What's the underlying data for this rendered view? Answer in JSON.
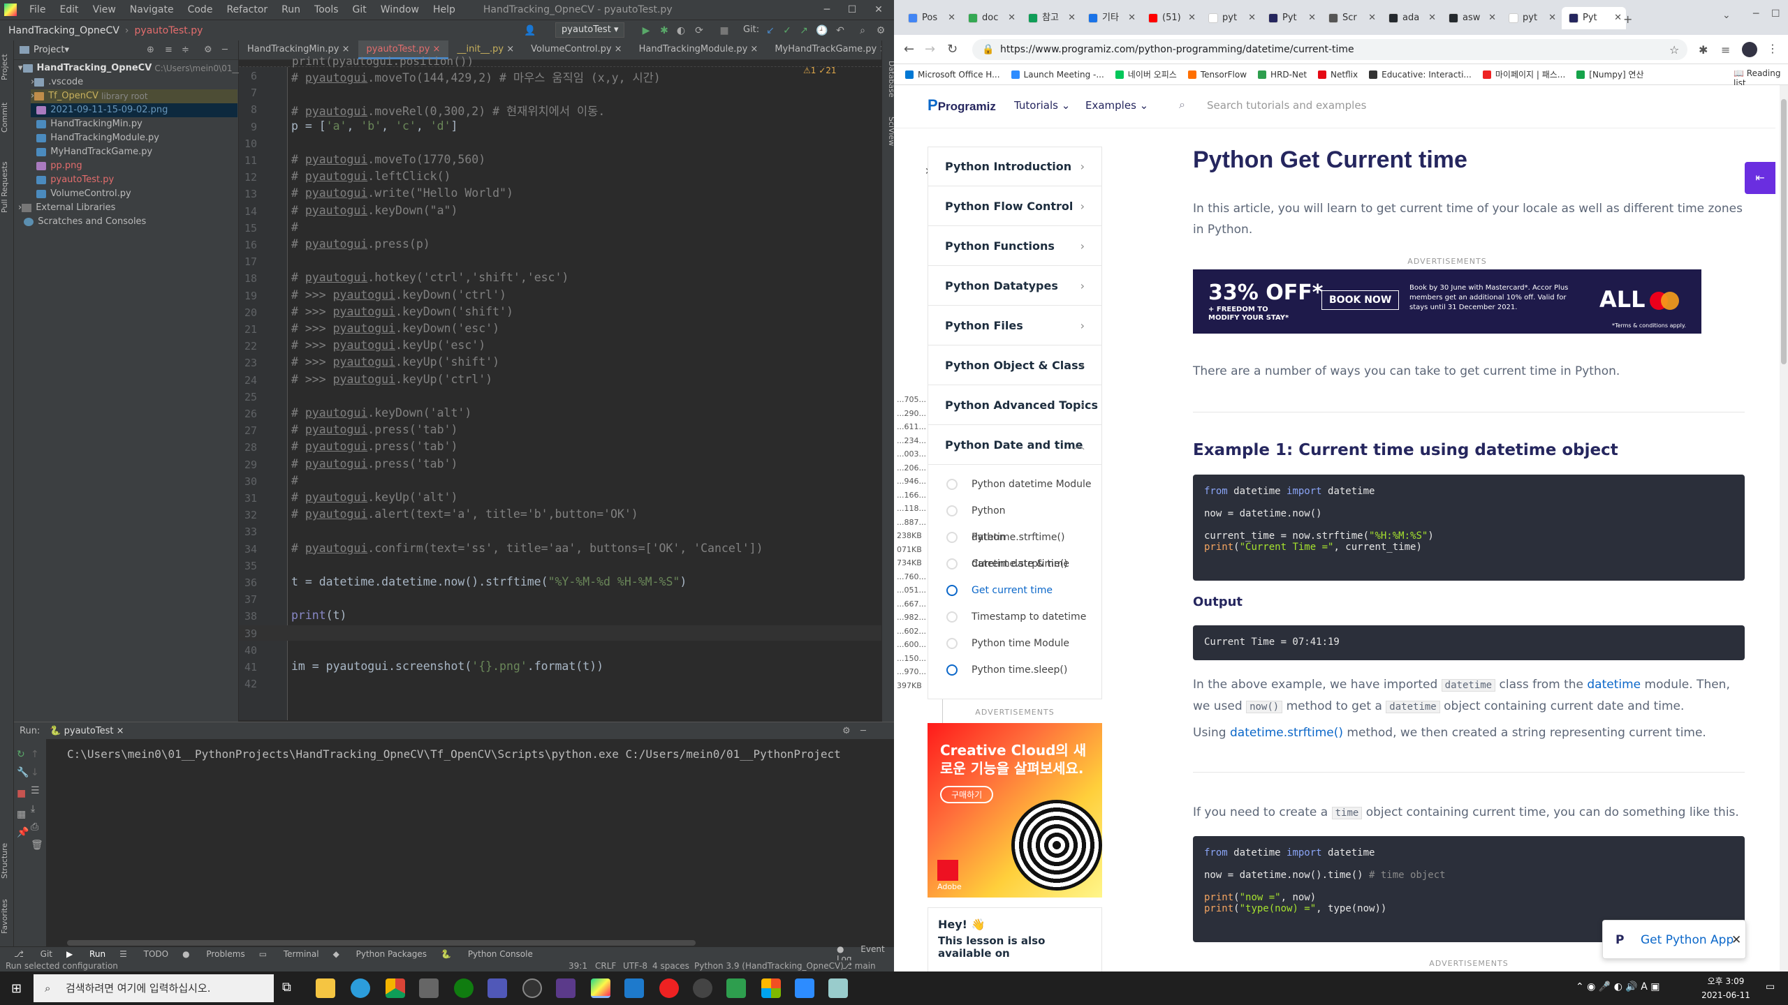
{
  "ide": {
    "menu": [
      "File",
      "Edit",
      "View",
      "Navigate",
      "Code",
      "Refactor",
      "Run",
      "Tools",
      "Git",
      "Window",
      "Help"
    ],
    "window_title": "HandTracking_OpneCV - pyautoTest.py",
    "breadcrumb": [
      "HandTracking_OpneCV",
      "pyautoTest.py"
    ],
    "run_config": "pyautoTest",
    "git_label": "Git:",
    "project_header": "Project",
    "tree": [
      {
        "label": "HandTracking_OpneCV",
        "extra": "C:\\Users\\mein0\\01__Py",
        "type": "folder"
      },
      {
        "label": ".vscode",
        "type": "folder"
      },
      {
        "label": "Tf_OpenCV",
        "extra": "library root",
        "type": "folder-lib"
      },
      {
        "label": "2021-09-11-15-09-02.png",
        "type": "png"
      },
      {
        "label": "HandTrackingMin.py",
        "type": "py"
      },
      {
        "label": "HandTrackingModule.py",
        "type": "py"
      },
      {
        "label": "MyHandTrackGame.py",
        "type": "py"
      },
      {
        "label": "pp.png",
        "type": "png-red"
      },
      {
        "label": "pyautoTest.py",
        "type": "py-red"
      },
      {
        "label": "VolumeControl.py",
        "type": "py"
      },
      {
        "label": "External Libraries",
        "type": "lib"
      },
      {
        "label": "Scratches and Consoles",
        "type": "scratch"
      }
    ],
    "tabs": [
      "HandTrackingMin.py",
      "pyautoTest.py",
      "__init__.py",
      "VolumeControl.py",
      "HandTrackingModule.py",
      "MyHandTrackGame.py"
    ],
    "active_tab": 1,
    "inspection": "⚠1 ✓21",
    "line_numbers": [
      "6",
      "7",
      "8",
      "9",
      "10",
      "11",
      "12",
      "13",
      "14",
      "15",
      "16",
      "17",
      "18",
      "19",
      "20",
      "21",
      "22",
      "23",
      "24",
      "25",
      "26",
      "27",
      "28",
      "29",
      "30",
      "31",
      "32",
      "33",
      "34",
      "35",
      "36",
      "37",
      "38",
      "39",
      "40",
      "41",
      "42"
    ],
    "code": {
      "l6a": "# ",
      "l6b": "pyautogui",
      "l6c": ".moveTo(144,429,2) # 마우스 움직임 (x,y, 시간)",
      "l8a": "# ",
      "l8b": "pyautogui",
      "l8c": ".moveRel(0,300,2) # 현재위치에서 이동.",
      "l9a": "p = [",
      "l9b": "'a'",
      "l9c": ", ",
      "l9d": "'b'",
      "l9e": ", ",
      "l9f": "'c'",
      "l9g": ", ",
      "l9h": "'d'",
      "l9i": "]",
      "l11": ".moveTo(1770,560)",
      "l12": ".leftClick()",
      "l13": ".write(\"Hello World\")",
      "l14": ".keyDown(\"a\")",
      "l15": "#",
      "l16": ".press(p)",
      "l18": ".hotkey('ctrl','shift','esc')",
      "l19": ".keyDown('ctrl')",
      "l20": ".keyDown('shift')",
      "l21": ".keyDown('esc')",
      "l22": ".keyUp('esc')",
      "l23": ".keyUp('shift')",
      "l24": ".keyUp('ctrl')",
      "l26": ".keyDown('alt')",
      "l27": ".press('tab')",
      "l28": ".press('tab')",
      "l29": ".press('tab')",
      "l30": "#",
      "l31": ".keyUp('alt')",
      "l32": ".alert(text='a', title='b',button='OK')",
      "l34": ".confirm(text='ss', title='aa', buttons=['OK', 'Cancel'])",
      "l36a": "t = datetime.datetime.now().strftime(",
      "l36b": "\"%Y-%M-%d %H-%M-%S\"",
      "l36c": ")",
      "l38a": "print",
      "l38b": "(t)",
      "l41a": "im = pyautogui.screenshot(",
      "l41b": "'{}.png'",
      "l41c": ".format(t))",
      "hash": "# ",
      "hash_prompt": "# >>> ",
      "pg": "pyautogui"
    },
    "run": {
      "label": "Run:",
      "config": "pyautoTest",
      "output": "C:\\Users\\mein0\\01__PythonProjects\\HandTracking_OpneCV\\Tf_OpenCV\\Scripts\\python.exe C:/Users/mein0/01__PythonProject"
    },
    "bottom_tabs": [
      "Git",
      "Run",
      "TODO",
      "Problems",
      "Terminal",
      "Python Packages",
      "Python Console"
    ],
    "event_log": "Event Log",
    "status_left": "Run selected configuration",
    "status_right": [
      "39:1",
      "CRLF",
      "UTF-8",
      "4 spaces",
      "Python 3.9 (HandTracking_OpneCV)",
      "main"
    ],
    "left_strip": [
      "Project",
      "Commit",
      "Pull Requests",
      "Structure",
      "Favorites"
    ],
    "right_strip": [
      "Database",
      "SciView"
    ]
  },
  "browser": {
    "tabs": [
      "Pos",
      "doc",
      "참고",
      "기타",
      "(51)",
      "pyt",
      "Pyt",
      "Scr",
      "ada",
      "asw",
      "pyt",
      "Pyt"
    ],
    "url": "https://www.programiz.com/python-programming/datetime/current-time",
    "bookmarks": [
      "Microsoft Office H...",
      "Launch Meeting -...",
      "네이버 오피스",
      "TensorFlow",
      "HRD-Net",
      "Netflix",
      "Educative: Interacti...",
      "마이페이지 | 패스...",
      "[Numpy] 연산"
    ],
    "reading_list": "Reading list",
    "site": {
      "logo": "Programiz",
      "tutorials": "Tutorials ⌄",
      "examples": "Examples ⌄",
      "search_placeholder": "Search tutorials and examples"
    },
    "sidenav": [
      "Python Introduction",
      "Python Flow Control",
      "Python Functions",
      "Python Datatypes",
      "Python Files",
      "Python Object & Class",
      "Python Advanced Topics",
      "Python Date and time"
    ],
    "subnav": [
      "Python datetime Module",
      "Python datetime.strftime()",
      "Python datetime.strptime()",
      "Current date & time",
      "Get current time",
      "Timestamp to datetime",
      "Python time Module",
      "Python time.sleep()"
    ],
    "article": {
      "title": "Python Get Current time",
      "intro": "In this article, you will learn to get current time of your locale as well as different time zones in Python.",
      "ads": "ADVERTISEMENTS",
      "ad_big": "33% OFF*",
      "ad_sub": "+ FREEDOM TO MODIFY YOUR STAY*",
      "ad_btn": "BOOK NOW",
      "ad_text": "Book by 30 June with Mastercard*. Accor Plus members get an additional 10% off. Valid for stays until 31 December 2021.",
      "ad_terms": "*Terms & conditions apply.",
      "ways": "There are a number of ways you can take to get current time in Python.",
      "ex1_title": "Example 1: Current time using datetime object",
      "code1": {
        "kw1": "from",
        "m1": " datetime ",
        "kw2": "import",
        "m2": " datetime",
        "l2": "now = datetime.now()",
        "l3a": "current_time = now.strftime(",
        "l3b": "\"%H:%M:%S\"",
        "l3c": ")",
        "l4a": "print",
        "l4b": "(",
        "l4c": "\"Current Time =\"",
        "l4d": ", current_time)"
      },
      "output_label": "Output",
      "output": "Current Time = 07:41:19",
      "p1a": "In the above example, we have imported ",
      "p1_code1": "datetime",
      "p1b": " class from the ",
      "p1_link": "datetime",
      "p1c": " module. Then, we used ",
      "p1_code2": "now()",
      "p1d": " method to get a ",
      "p1_code3": "datetime",
      "p1e": " object containing current date and time.",
      "p2a": "Using ",
      "p2_link": "datetime.strftime()",
      "p2b": " method, we then created a string representing current time.",
      "p3a": "If you need to create a ",
      "p3_code": "time",
      "p3b": " object containing current time, you can do something like this.",
      "code2": {
        "kw1": "from",
        "m1": " datetime ",
        "kw2": "import",
        "m2": " datetime",
        "l2a": "now = datetime.now().time() ",
        "l2b": "# time object",
        "l3a": "print",
        "l3b": "(",
        "l3c": "\"now =\"",
        "l3d": ", now)",
        "l4a": "print",
        "l4b": "(",
        "l4c": "\"type(now) =\"",
        "l4d": ", type(now))"
      }
    },
    "side_ad": {
      "title": "Creative Cloud의 새로운 기능을 살펴보세요.",
      "btn": "구매하기",
      "brand": "Adobe"
    },
    "hey": "Hey! 👋",
    "hey_sub": "This lesson is also available on",
    "app_btn": "Get Python App",
    "dialog_values": [
      "...705...",
      "...290...",
      "...611...",
      "...234...",
      "...003...",
      "...206...",
      "...946...",
      "...166...",
      "...118...",
      "...887...",
      "238KB",
      "071KB",
      "734KB",
      "...760...",
      "...051...",
      "...667...",
      "...982...",
      "...602...",
      "...600...",
      "...150...",
      "...970...",
      "397KB"
    ]
  },
  "taskbar": {
    "search": "검색하려면 여기에 입력하십시오.",
    "time": "오후 3:09",
    "date": "2021-06-11"
  },
  "colors": {
    "ide_bg": "#2b2b2b",
    "accent": "#0b67c9",
    "comment": "#808080",
    "string": "#6a8759"
  }
}
